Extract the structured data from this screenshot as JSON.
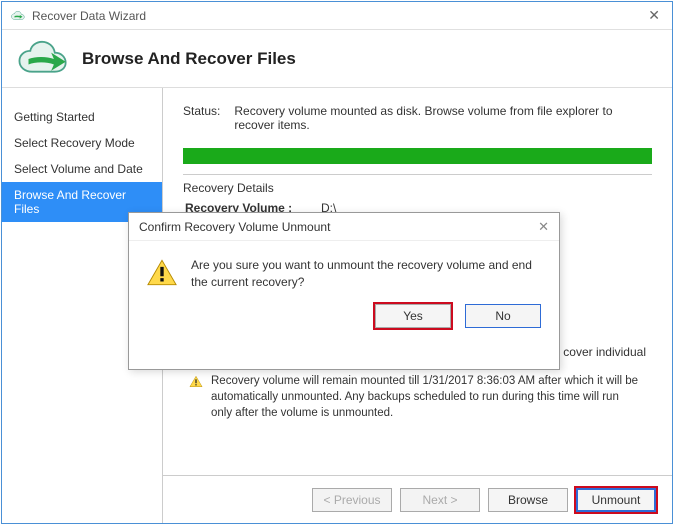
{
  "titlebar": {
    "title": "Recover Data Wizard"
  },
  "header": {
    "title": "Browse And Recover Files"
  },
  "sidebar": {
    "items": [
      {
        "label": "Getting Started"
      },
      {
        "label": "Select Recovery Mode"
      },
      {
        "label": "Select Volume and Date"
      },
      {
        "label": "Browse And Recover Files"
      }
    ],
    "active_index": 3
  },
  "content": {
    "status_label": "Status:",
    "status_text": "Recovery volume mounted as disk. Browse volume from file explorer to recover items.",
    "details_title": "Recovery Details",
    "recovery_volume_label": "Recovery Volume :",
    "recovery_volume_value": "D:\\",
    "trailing_partial": "cover individual",
    "warning_text": "Recovery volume will remain mounted till 1/31/2017 8:36:03 AM after which it will be automatically unmounted. Any backups scheduled to run during this time will run only after the volume is unmounted."
  },
  "footer": {
    "previous": "< Previous",
    "next": "Next >",
    "browse": "Browse",
    "unmount": "Unmount"
  },
  "modal": {
    "title": "Confirm Recovery Volume Unmount",
    "message": "Are you sure you want to unmount the recovery volume and end the current recovery?",
    "yes": "Yes",
    "no": "No"
  }
}
